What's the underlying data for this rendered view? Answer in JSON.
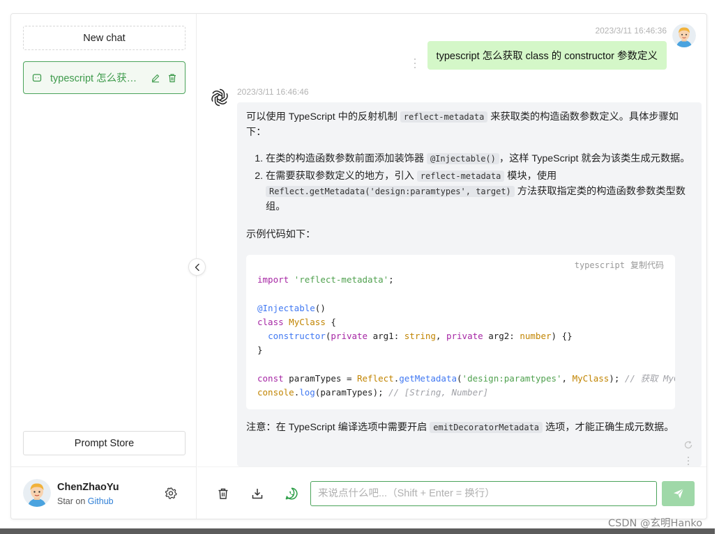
{
  "sidebar": {
    "new_chat_label": "New chat",
    "chat_items": [
      {
        "label": "typescript 怎么获取 class 的 constructor 参数定义"
      }
    ],
    "prompt_store_label": "Prompt Store",
    "user": {
      "name": "ChenZhaoYu",
      "star_prefix": "Star on",
      "star_link": "Github"
    }
  },
  "conversation": {
    "user_message": {
      "time": "2023/3/11 16:46:36",
      "text": "typescript 怎么获取 class 的 constructor 参数定义"
    },
    "bot_message": {
      "time": "2023/3/11 16:46:46",
      "intro_before": "可以使用 TypeScript 中的反射机制 ",
      "intro_code": "reflect-metadata",
      "intro_after": " 来获取类的构造函数参数定义。具体步骤如下：",
      "steps": [
        {
          "before": "在类的构造函数参数前面添加装饰器 ",
          "code": "@Injectable()",
          "after": "，这样 TypeScript 就会为该类生成元数据。"
        },
        {
          "before": "在需要获取参数定义的地方，引入 ",
          "code": "reflect-metadata",
          "middle": " 模块，使用 ",
          "code2": "Reflect.getMetadata('design:paramtypes', target)",
          "after": " 方法获取指定类的构造函数参数类型数组。"
        }
      ],
      "sample_label": "示例代码如下：",
      "code_block": {
        "language": "typescript",
        "copy_label": "复制代码",
        "lines": [
          "import 'reflect-metadata';",
          "",
          "@Injectable()",
          "class MyClass {",
          "  constructor(private arg1: string, private arg2: number) {}",
          "}",
          "",
          "const paramTypes = Reflect.getMetadata('design:paramtypes', MyClass); // 获取 MyClass",
          "console.log(paramTypes); // [String, Number]"
        ]
      },
      "note_before": "注意：在 TypeScript 编译选项中需要开启 ",
      "note_code": "emitDecoratorMetadata",
      "note_after": " 选项，才能正确生成元数据。"
    }
  },
  "input": {
    "placeholder": "来说点什么吧...（Shift + Enter = 换行）",
    "value": ""
  },
  "watermark": "CSDN @玄明Hanko",
  "colors": {
    "accent": "#4aa35a",
    "user_bubble": "#d4f7c8",
    "bot_bubble": "#f3f4f6",
    "send_button": "#9fd8a8"
  },
  "icons": {
    "chat_item": "message-icon",
    "edit": "edit-icon",
    "delete": "trash-icon",
    "settings": "gear-icon",
    "collapse": "chevron-left-icon",
    "clear": "trash-icon",
    "download": "download-icon",
    "whatsapp": "whatsapp-icon",
    "send": "send-icon",
    "refresh": "refresh-icon",
    "more": "more-vertical-icon"
  }
}
